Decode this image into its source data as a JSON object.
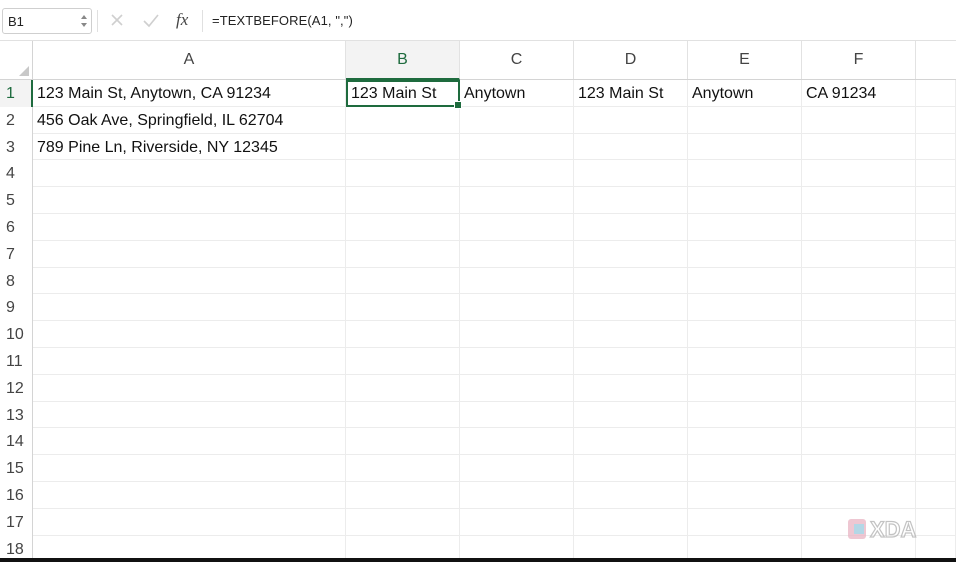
{
  "formula_bar": {
    "name_box": "B1",
    "fx_label": "fx",
    "formula": "=TEXTBEFORE(A1, \",\")"
  },
  "columns": [
    "A",
    "B",
    "C",
    "D",
    "E",
    "F"
  ],
  "rows": [
    "1",
    "2",
    "3",
    "4",
    "5",
    "6",
    "7",
    "8",
    "9",
    "10",
    "11",
    "12",
    "13",
    "14",
    "15",
    "16",
    "17",
    "18"
  ],
  "cells": {
    "A1": "123 Main St, Anytown, CA 91234",
    "A2": "456 Oak Ave, Springfield, IL 62704",
    "A3": "789 Pine Ln, Riverside, NY 12345",
    "B1": "123 Main St",
    "C1": "Anytown",
    "D1": "123 Main St",
    "E1": "Anytown",
    "F1": "CA 91234"
  },
  "selection": {
    "active_cell": "B1",
    "active_column": "B",
    "active_row": "1"
  },
  "colors": {
    "accent": "#1e6b3e",
    "grid": "#ececec",
    "header_text": "#444444"
  },
  "watermark": "XDA"
}
